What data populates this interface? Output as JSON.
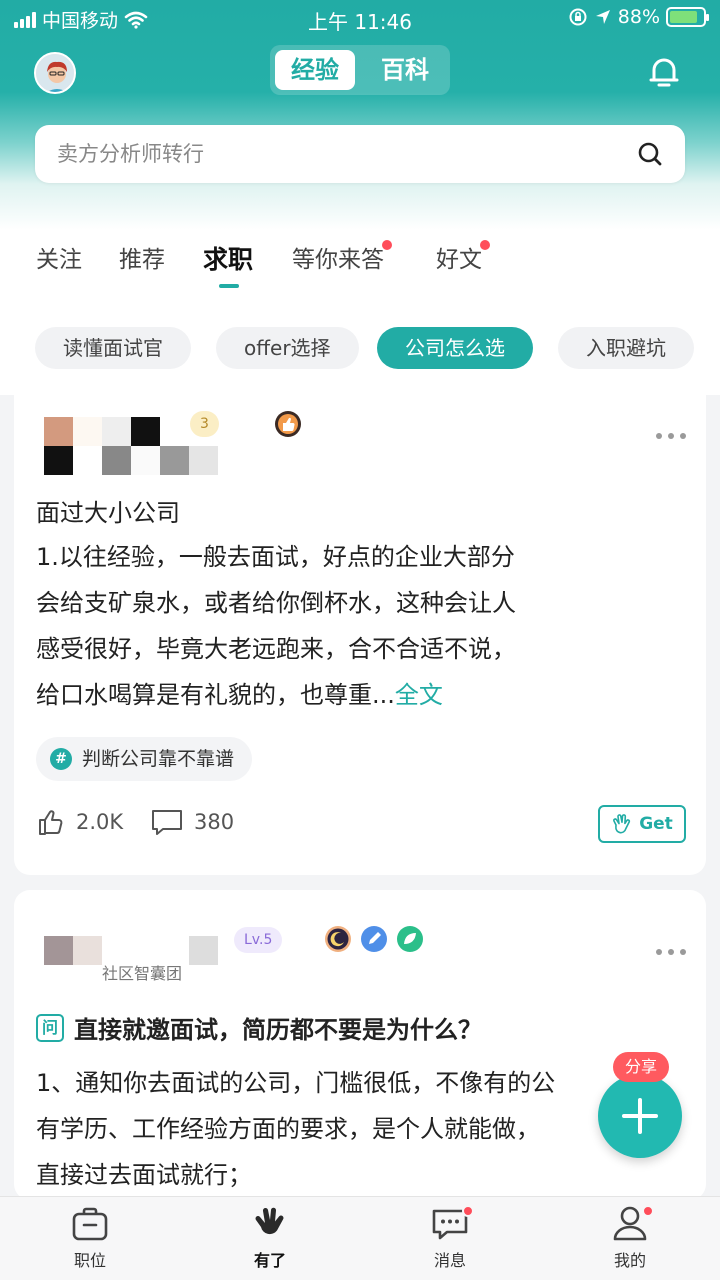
{
  "status_bar": {
    "carrier": "中国移动",
    "time": "上午 11:46",
    "battery": "88%"
  },
  "header": {
    "segments": [
      "经验",
      "百科"
    ],
    "active_segment": "经验",
    "search_placeholder": "卖方分析师转行"
  },
  "tabs": [
    {
      "label": "关注",
      "active": false,
      "dot": false
    },
    {
      "label": "推荐",
      "active": false,
      "dot": false
    },
    {
      "label": "求职",
      "active": true,
      "dot": false
    },
    {
      "label": "等你来答",
      "active": false,
      "dot": true
    },
    {
      "label": "好文",
      "active": false,
      "dot": true
    }
  ],
  "chips": [
    {
      "label": "读懂面试官",
      "active": false
    },
    {
      "label": "offer选择",
      "active": false
    },
    {
      "label": "公司怎么选",
      "active": true
    },
    {
      "label": "入职避坑",
      "active": false
    }
  ],
  "post1": {
    "level_badge": "3",
    "title": "面过大小公司",
    "lines": [
      "1.以往经验，一般去面试，好点的企业大部分",
      "会给支矿泉水，或者给你倒杯水，这种会让人",
      "感受很好，毕竟大老远跑来，合不合适不说，",
      "给口水喝算是有礼貌的，也尊重..."
    ],
    "read_more": "全文",
    "topic": "判断公司靠不靠谱",
    "likes": "2.0K",
    "comments": "380",
    "get_label": "Get"
  },
  "post2": {
    "level_badge": "Lv.5",
    "author_sub": "社区智囊团",
    "question_tag": "问",
    "title": "直接就邀面试，简历都不要是为什么？",
    "lines": [
      "1、通知你去面试的公司，门槛很低，不像有的公",
      "有学历、工作经验方面的要求，是个人就能做，",
      "直接过去面试就行；"
    ]
  },
  "fab": {
    "share_label": "分享"
  },
  "bottom_nav": [
    {
      "label": "职位",
      "icon": "briefcase-icon",
      "active": false,
      "dot": false
    },
    {
      "label": "有了",
      "icon": "hand-icon",
      "active": true,
      "dot": false
    },
    {
      "label": "消息",
      "icon": "message-icon",
      "active": false,
      "dot": true
    },
    {
      "label": "我的",
      "icon": "person-icon",
      "active": false,
      "dot": true
    }
  ],
  "colors": {
    "brand": "#22aca5",
    "notification_dot": "#ff4d5a",
    "share_badge": "#ff5a5f"
  }
}
